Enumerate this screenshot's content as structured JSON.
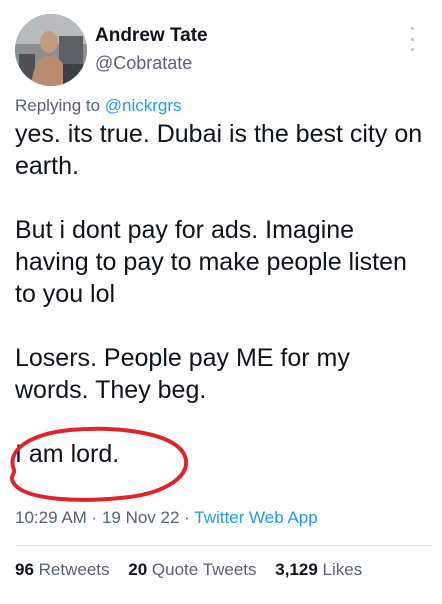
{
  "author": {
    "name": "Andrew Tate",
    "handle": "@Cobratate"
  },
  "reply": {
    "prefix": "Replying to ",
    "mention": "@nickrgrs"
  },
  "tweet": {
    "paragraphs": [
      "yes. its true. Dubai is the best city on earth.",
      "But i dont pay for ads. Imagine having to pay to make people listen to you lol",
      "Losers. People pay ME for my words. They beg.",
      "I am lord."
    ]
  },
  "meta": {
    "time": "10:29 AM",
    "date": "19 Nov 22",
    "source": "Twitter Web App",
    "separator": " · "
  },
  "stats": {
    "retweets_count": "96",
    "retweets_label": "Retweets",
    "quote_count": "20",
    "quote_label": "Quote Tweets",
    "likes_count": "3,129",
    "likes_label": "Likes"
  },
  "colors": {
    "link": "#1d9bf0",
    "secondary_text": "#536471",
    "annotation_circle": "#e0242b"
  },
  "icons": {
    "more": "more-vertical-icon"
  }
}
